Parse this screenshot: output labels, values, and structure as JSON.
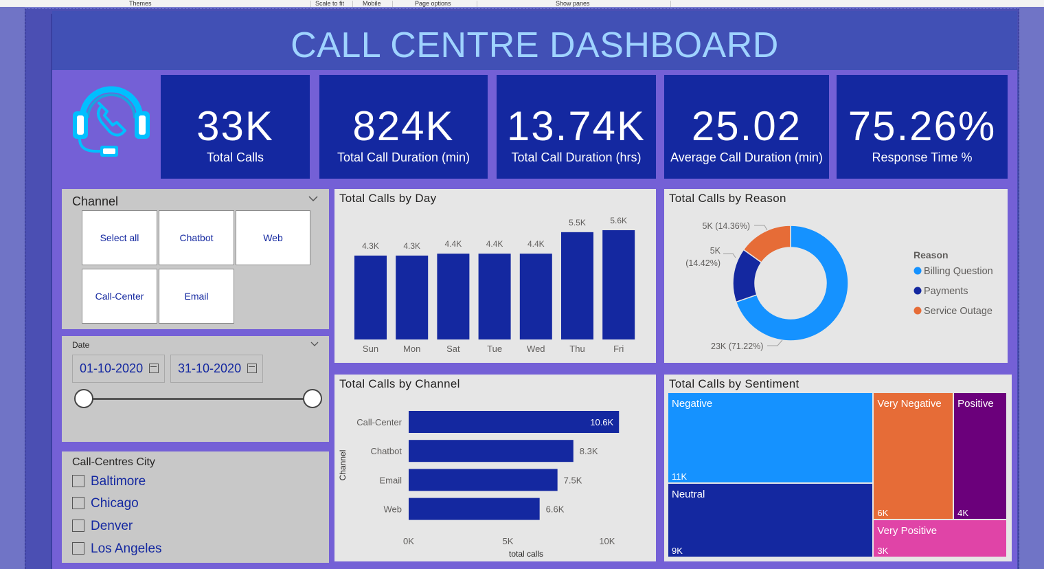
{
  "ribbon": {
    "items": [
      "Themes",
      "Scale to fit",
      "Mobile",
      "Page options",
      "Show panes"
    ]
  },
  "header": {
    "title": "CALL CENTRE DASHBOARD"
  },
  "colors": {
    "kpi_bg": "#1428a0",
    "header_bg": "#4150b5",
    "page_bg": "#7460d6",
    "title_color": "#9fd3ff",
    "bar_color": "#1428a0",
    "billing": "#1592ff",
    "payments": "#1428a0",
    "outage": "#e66c37"
  },
  "logo": {
    "icon": "headset-phone-icon"
  },
  "kpis": [
    {
      "value": "33K",
      "label": "Total Calls"
    },
    {
      "value": "824K",
      "label": "Total Call Duration (min)"
    },
    {
      "value": "13.74K",
      "label": "Total Call Duration (hrs)"
    },
    {
      "value": "25.02",
      "label": "Average Call Duration (min)"
    },
    {
      "value": "75.26%",
      "label": "Response Time %"
    }
  ],
  "channel_slicer": {
    "title": "Channel",
    "tiles": [
      "Select all",
      "Chatbot",
      "Web",
      "Call-Center",
      "Email"
    ]
  },
  "date_slicer": {
    "title": "Date",
    "start": "01-10-2020",
    "end": "31-10-2020"
  },
  "city_slicer": {
    "title": "Call-Centres City",
    "items": [
      "Baltimore",
      "Chicago",
      "Denver",
      "Los Angeles"
    ]
  },
  "chart_data": [
    {
      "type": "bar",
      "title": "Total Calls by Day",
      "categories": [
        "Sun",
        "Mon",
        "Sat",
        "Tue",
        "Wed",
        "Thu",
        "Fri"
      ],
      "values": [
        4300,
        4300,
        4400,
        4400,
        4400,
        5500,
        5600
      ],
      "data_labels": [
        "4.3K",
        "4.3K",
        "4.4K",
        "4.4K",
        "4.4K",
        "5.5K",
        "5.6K"
      ],
      "ylim": [
        0,
        5600
      ]
    },
    {
      "type": "pie",
      "title": "Total Calls by Reason",
      "legend_title": "Reason",
      "legend_position": "right",
      "categories": [
        "Billing Question",
        "Payments",
        "Service Outage"
      ],
      "values": [
        23000,
        5000,
        5000
      ],
      "percents": [
        71.22,
        14.42,
        14.36
      ],
      "data_labels": [
        "23K (71.22%)",
        "5K",
        "(14.42%)",
        "5K (14.36%)"
      ]
    },
    {
      "type": "bar",
      "orientation": "horizontal",
      "title": "Total Calls by Channel",
      "ylabel": "Channel",
      "xlabel": "total calls",
      "categories": [
        "Call-Center",
        "Chatbot",
        "Email",
        "Web"
      ],
      "values": [
        10600,
        8300,
        7500,
        6600
      ],
      "data_labels": [
        "10.6K",
        "8.3K",
        "7.5K",
        "6.6K"
      ],
      "xticks": [
        "0K",
        "5K",
        "10K"
      ],
      "xlim": [
        0,
        10800
      ]
    },
    {
      "type": "treemap",
      "title": "Total Calls by Sentiment",
      "categories": [
        "Negative",
        "Neutral",
        "Very Negative",
        "Positive",
        "Very Positive"
      ],
      "values": [
        11000,
        9000,
        6000,
        4000,
        3000
      ],
      "data_labels": [
        "11K",
        "9K",
        "6K",
        "4K",
        "3K"
      ],
      "colors": [
        "#1592ff",
        "#1428a0",
        "#e66c37",
        "#6b007b",
        "#e044a7"
      ]
    }
  ]
}
